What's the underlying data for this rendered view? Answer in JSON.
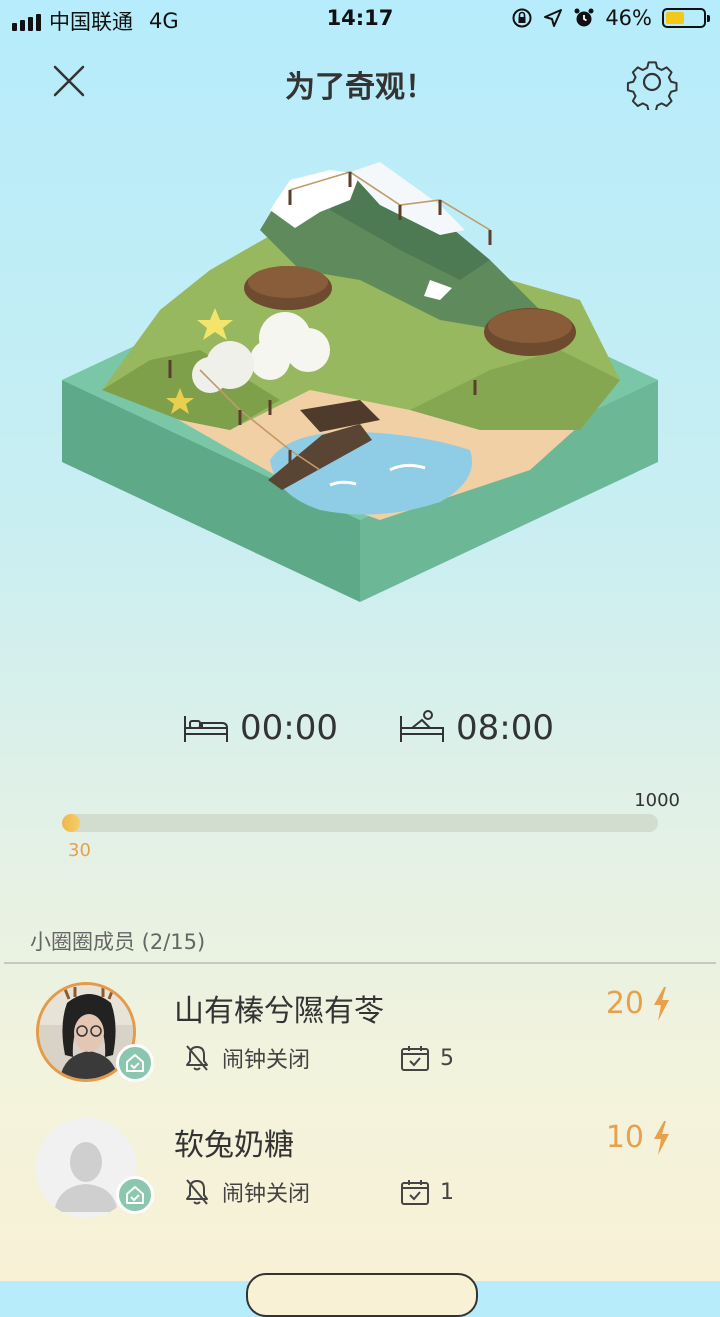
{
  "status_bar": {
    "carrier": "中国联通",
    "network": "4G",
    "time": "14:17",
    "battery_percent": "46%",
    "battery_level": 0.46
  },
  "header": {
    "title": "为了奇观！",
    "close_icon": "close-icon",
    "settings_icon": "gear-icon"
  },
  "island": {
    "image": "isometric-island-illustration"
  },
  "sleep": {
    "bedtime": "00:00",
    "wake_time": "08:00",
    "bed_icon": "bed-icon",
    "wake_icon": "wake-up-icon"
  },
  "progress": {
    "current": "30",
    "max": "1000",
    "fraction": 0.03
  },
  "members": {
    "title": "小圈圈成员 (2/15)",
    "list": [
      {
        "name": "山有榛兮隰有苓",
        "score": "20",
        "alarm_status": "闹钟关闭",
        "check_days": "5",
        "avatar": "photo"
      },
      {
        "name": "软兔奶糖",
        "score": "10",
        "alarm_status": "闹钟关闭",
        "check_days": "1",
        "avatar": "default"
      }
    ]
  },
  "colors": {
    "accent": "#e6a14a",
    "badge": "#8bc7ae",
    "progress_track": "#d2dccf"
  }
}
